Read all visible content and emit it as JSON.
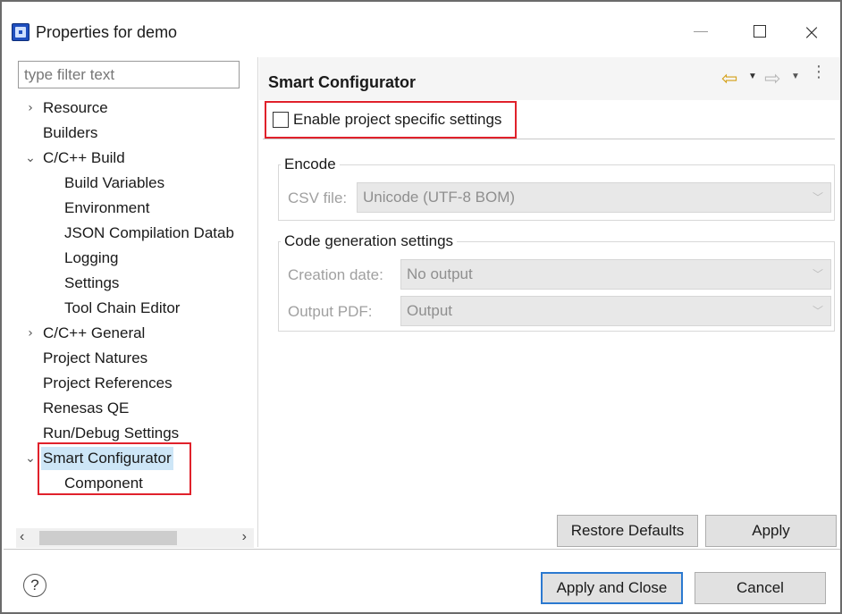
{
  "window": {
    "title": "Properties for demo"
  },
  "filter": {
    "placeholder": "type filter text"
  },
  "tree": {
    "items": [
      {
        "label": "Resource",
        "toggle": ">"
      },
      {
        "label": "Builders"
      },
      {
        "label": "C/C++ Build",
        "toggle": "v"
      },
      {
        "label": "Build Variables"
      },
      {
        "label": "Environment"
      },
      {
        "label": "JSON Compilation Datab"
      },
      {
        "label": "Logging"
      },
      {
        "label": "Settings"
      },
      {
        "label": "Tool Chain Editor"
      },
      {
        "label": "C/C++ General",
        "toggle": ">"
      },
      {
        "label": "Project Natures"
      },
      {
        "label": "Project References"
      },
      {
        "label": "Renesas QE"
      },
      {
        "label": "Run/Debug Settings"
      },
      {
        "label": "Smart Configurator",
        "toggle": "v",
        "selected": true
      },
      {
        "label": "Component"
      }
    ]
  },
  "page": {
    "title": "Smart Configurator",
    "enable_label": "Enable project specific settings",
    "enable_checked": false,
    "encode": {
      "title": "Encode",
      "csv_label": "CSV file:",
      "csv_value": "Unicode (UTF-8 BOM)"
    },
    "codegen": {
      "title": "Code generation settings",
      "creation_label": "Creation date:",
      "creation_value": "No output",
      "pdf_label": "Output PDF:",
      "pdf_value": "Output"
    },
    "restore_defaults": "Restore Defaults",
    "apply": "Apply"
  },
  "footer": {
    "help": "?",
    "apply_close": "Apply and Close",
    "cancel": "Cancel"
  },
  "colors": {
    "highlight": "#e0212b",
    "selection": "#cde6f7",
    "primary_border": "#2b79d0"
  },
  "icons": {
    "app": "app-icon",
    "back": "nav-back-icon",
    "forward": "nav-forward-icon",
    "more": "view-menu-icon"
  }
}
